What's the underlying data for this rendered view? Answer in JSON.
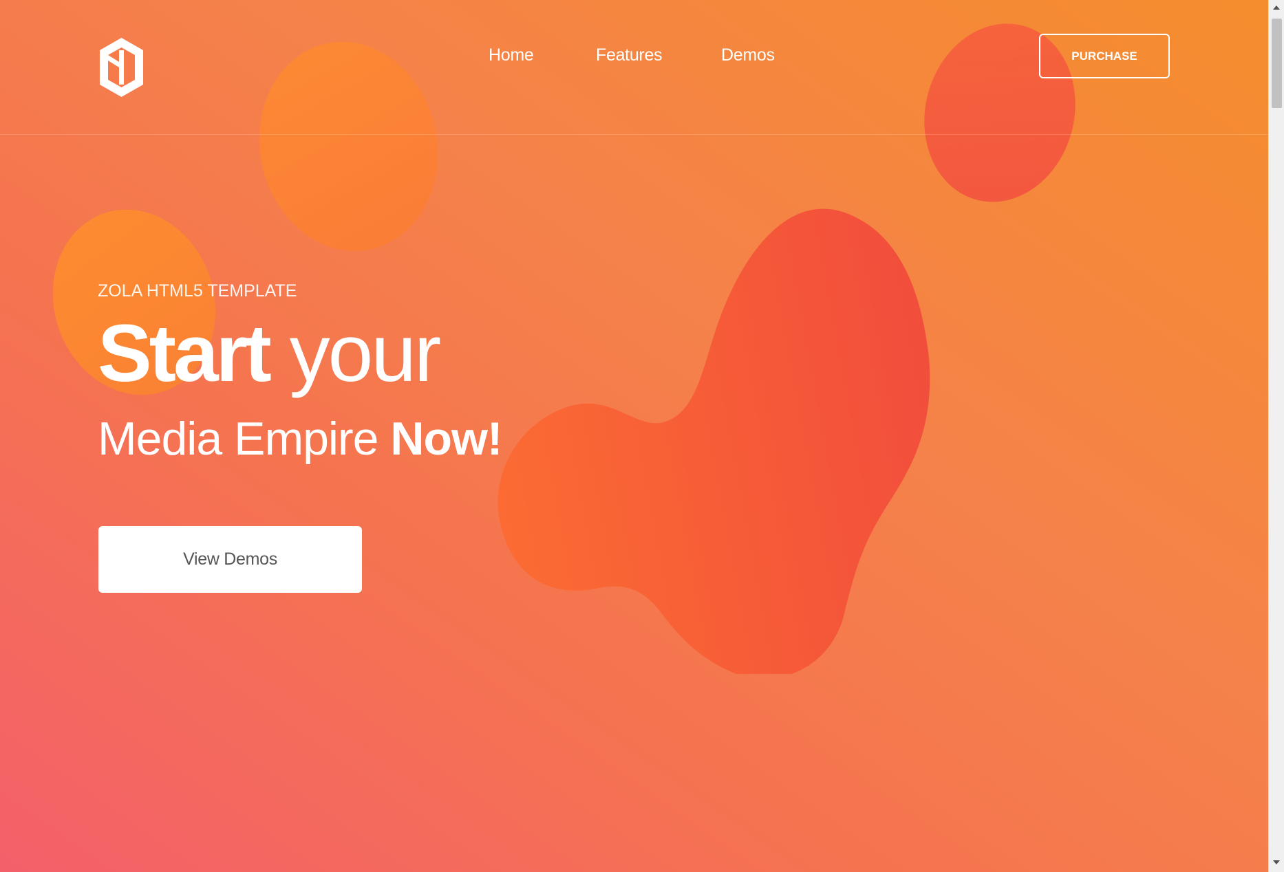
{
  "colors": {
    "gradient_start": "#f4606a",
    "gradient_end": "#f58d2d",
    "blob_accent": "#f25140",
    "button_text": "#555555"
  },
  "header": {
    "logo_icon": "hexagon-logo-icon",
    "nav": [
      {
        "label": "Home"
      },
      {
        "label": "Features"
      },
      {
        "label": "Demos"
      }
    ],
    "purchase_label": "PURCHASE"
  },
  "hero": {
    "eyebrow": "ZOLA HTML5 TEMPLATE",
    "line1_bold": "Start",
    "line1_light": " your",
    "line2_light": "Media Empire ",
    "line2_bold": "Now!",
    "cta_label": "View Demos"
  }
}
